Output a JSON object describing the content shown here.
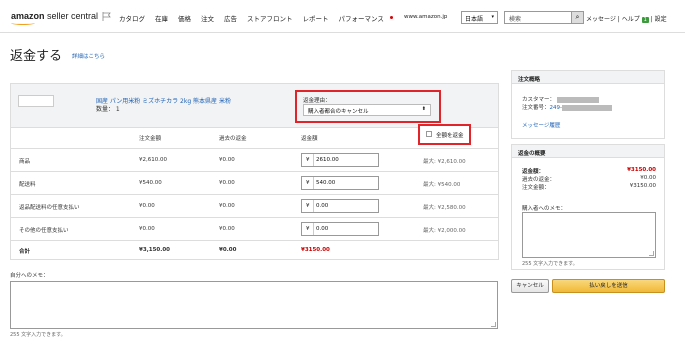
{
  "topbar": {
    "logo_amazon": "amazon",
    "logo_rest": " seller central",
    "nav": [
      "カタログ",
      "在庫",
      "価格",
      "注文",
      "広告",
      "ストアフロント",
      "レポート",
      "パフォーマンス"
    ],
    "marketplace": "www.amazon.jp",
    "language": "日本語",
    "search_placeholder": "検索",
    "links": "メッセージ | ヘルプ",
    "badge": "1",
    "settings": " | 設定",
    "colors": {
      "accent_orange": "#f0a020",
      "badge_green": "#3c9b3c",
      "link_blue": "#1e62b5"
    }
  },
  "page": {
    "title": "返金する",
    "details_link": "詳細はこちら"
  },
  "product": {
    "name": "国産 パン用米粉 ミズホチカラ 2kg 熊本県産 米粉",
    "qty": "数量： 1",
    "reason_label": "返金理由：",
    "reason_value": "購入者都合のキャンセル",
    "full_refund_label": "全額を返金"
  },
  "table": {
    "headers": [
      "注文金額",
      "過去の返金",
      "返金額"
    ],
    "rows": [
      {
        "label": "商品",
        "order": "¥2,610.00",
        "past": "¥0.00",
        "yen": "¥",
        "input": "2610.00",
        "max": "最大: ¥2,610.00"
      },
      {
        "label": "配送料",
        "order": "¥540.00",
        "past": "¥0.00",
        "yen": "¥",
        "input": "540.00",
        "max": "最大: ¥540.00"
      },
      {
        "label": "返品配送料の任意支払い",
        "order": "¥0.00",
        "past": "¥0.00",
        "yen": "¥",
        "input": "0.00",
        "max": "最大: ¥2,580.00"
      },
      {
        "label": "その他の任意支払い",
        "order": "¥0.00",
        "past": "¥0.00",
        "yen": "¥",
        "input": "0.00",
        "max": "最大: ¥2,000.00"
      }
    ],
    "total": {
      "label": "合計",
      "order": "¥3,150.00",
      "past": "¥0.00",
      "refund": "¥3150.00"
    }
  },
  "memo": {
    "label": "自分へのメモ：",
    "count": "255 文字入力できます。"
  },
  "order_summary": {
    "title": "注文概略",
    "customer_label": "カスタマー：",
    "order_label": "注文番号：",
    "order_value": "249-",
    "message_link": "メッセージ履歴"
  },
  "refund_summary": {
    "title": "返金の概要",
    "rows": [
      {
        "label": "返金額：",
        "value": "¥3150.00"
      },
      {
        "label": "過去の返金：",
        "value": "¥0.00"
      },
      {
        "label": "注文金額：",
        "value": "¥3150.00"
      }
    ],
    "buyer_memo_label": "購入者へのメモ：",
    "buyer_count": "255 文字入力できます。"
  },
  "buttons": {
    "cancel": "キャンセル",
    "submit": "払い戻しを送信"
  }
}
